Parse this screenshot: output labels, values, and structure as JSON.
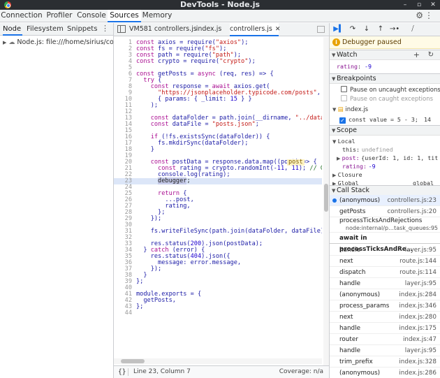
{
  "window": {
    "title": "DevTools - Node.js",
    "minimize": "–",
    "maximize": "▫",
    "close": "✕"
  },
  "main_tabs": [
    {
      "label": "Connection"
    },
    {
      "label": "Profiler"
    },
    {
      "label": "Console"
    },
    {
      "label": "Sources"
    },
    {
      "label": "Memory"
    }
  ],
  "navigator": {
    "tabs": [
      {
        "label": "Node"
      },
      {
        "label": "Filesystem"
      },
      {
        "label": "Snippets"
      }
    ],
    "tree_item": "Node.js: file:///home/sirius/coding/a"
  },
  "editor": {
    "tabs": [
      {
        "label": "VM581 controllers.js"
      },
      {
        "label": "index.js"
      },
      {
        "label": "controllers.js"
      }
    ],
    "close_glyph": "✕",
    "inline_value": "post",
    "status": {
      "braces": "{}",
      "position": "Line 23, Column 7",
      "coverage": "Coverage: n/a"
    },
    "lines": [
      {
        "n": "1",
        "html": "<span class=\"kw\">const</span> axios = require(<span class=\"str\">\"axios\"</span>);"
      },
      {
        "n": "2",
        "html": "<span class=\"kw\">const</span> fs = require(<span class=\"str\">\"fs\"</span>);"
      },
      {
        "n": "3",
        "html": "<span class=\"kw\">const</span> path = require(<span class=\"str\">\"path\"</span>);"
      },
      {
        "n": "4",
        "html": "<span class=\"kw\">const</span> crypto = require(<span class=\"str\">\"crypto\"</span>);"
      },
      {
        "n": "5",
        "html": ""
      },
      {
        "n": "6",
        "html": "<span class=\"kw\">const</span> getPosts = <span class=\"kw\">async</span> (req, res) => {"
      },
      {
        "n": "7",
        "html": "  <span class=\"kw\">try</span> {"
      },
      {
        "n": "8",
        "html": "    <span class=\"kw\">const</span> response = <span class=\"kw\">await</span> axios.get("
      },
      {
        "n": "9",
        "html": "      <span class=\"str\">\"https://jsonplaceholder.typicode.com/posts\"</span>,"
      },
      {
        "n": "10",
        "html": "      { params: { _limit: <span class=\"num\">15</span> } }"
      },
      {
        "n": "11",
        "html": "    );"
      },
      {
        "n": "12",
        "html": ""
      },
      {
        "n": "13",
        "html": "    <span class=\"kw\">const</span> dataFolder = path.join(__dirname, <span class=\"str\">\"../data\"</span>);"
      },
      {
        "n": "14",
        "html": "    <span class=\"kw\">const</span> dataFile = <span class=\"str\">\"posts.json\"</span>;"
      },
      {
        "n": "15",
        "html": ""
      },
      {
        "n": "16",
        "html": "    <span class=\"kw\">if</span> (!fs.existsSync(dataFolder)) {"
      },
      {
        "n": "17",
        "html": "      fs.mkdirSync(dataFolder);"
      },
      {
        "n": "18",
        "html": "    }"
      },
      {
        "n": "19",
        "html": ""
      },
      {
        "n": "20",
        "html": "    <span class=\"kw\">const</span> postData = response.data.map((post) => {"
      },
      {
        "n": "21",
        "html": "      <span class=\"kw\">const</span> rating = crypto.randomInt(-<span class=\"num\">11</span>, <span class=\"num\">11</span>); <span class=\"cm\">// Genera</span>"
      },
      {
        "n": "22",
        "html": "      console.log(rating);"
      },
      {
        "n": "23",
        "html": "      <span class=\"dbg\">debugger</span>;"
      },
      {
        "n": "24",
        "html": ""
      },
      {
        "n": "25",
        "html": "      <span class=\"kw\">return</span> {"
      },
      {
        "n": "26",
        "html": "        ...post,"
      },
      {
        "n": "27",
        "html": "        rating,"
      },
      {
        "n": "28",
        "html": "      };"
      },
      {
        "n": "29",
        "html": "    });"
      },
      {
        "n": "30",
        "html": ""
      },
      {
        "n": "31",
        "html": "    fs.writeFileSync(path.join(dataFolder, dataFile), JSO"
      },
      {
        "n": "32",
        "html": ""
      },
      {
        "n": "33",
        "html": "    res.status(<span class=\"num\">200</span>).json(postData);"
      },
      {
        "n": "34",
        "html": "  } <span class=\"kw\">catch</span> (error) {"
      },
      {
        "n": "35",
        "html": "    res.status(<span class=\"num\">404</span>).json({"
      },
      {
        "n": "36",
        "html": "      message: error.message,"
      },
      {
        "n": "37",
        "html": "    });"
      },
      {
        "n": "38",
        "html": "  }"
      },
      {
        "n": "39",
        "html": "};"
      },
      {
        "n": "40",
        "html": ""
      },
      {
        "n": "41",
        "html": "module.exports = {"
      },
      {
        "n": "42",
        "html": "  getPosts,"
      },
      {
        "n": "43",
        "html": "};"
      },
      {
        "n": "44",
        "html": ""
      }
    ]
  },
  "debugger": {
    "paused_text": "Debugger paused",
    "watch": {
      "title": "Watch",
      "expr": "rating",
      "value": "-9"
    },
    "breakpoints": {
      "title": "Breakpoints",
      "uncaught": "Pause on uncaught exceptions",
      "caught": "Pause on caught exceptions",
      "file": "index.js",
      "bp_code": "const value = 5 - 3;",
      "bp_line": "14"
    },
    "scope": {
      "title": "Scope",
      "local": "Local",
      "this_key": "this:",
      "this_val": "undefined",
      "post_key": "post:",
      "post_val": "{userId: 1, id: 1, tit",
      "rating_key": "rating:",
      "rating_val": "-9",
      "closure": "Closure",
      "global": "Global",
      "global_val": "global"
    },
    "call_stack": {
      "title": "Call Stack",
      "frames": [
        {
          "fn": "(anonymous)",
          "loc": "controllers.js:23"
        },
        {
          "fn": "getPosts",
          "loc": "controllers.js:20"
        },
        {
          "fn": "processTicksAndRejections",
          "loc": "node:internal/p…task_queues:95"
        },
        {
          "fn": "await in processTicksAndRe…",
          "loc": ""
        },
        {
          "fn": "handle",
          "loc": "layer.js:95"
        },
        {
          "fn": "next",
          "loc": "route.js:144"
        },
        {
          "fn": "dispatch",
          "loc": "route.js:114"
        },
        {
          "fn": "handle",
          "loc": "layer.js:95"
        },
        {
          "fn": "(anonymous)",
          "loc": "index.js:284"
        },
        {
          "fn": "process_params",
          "loc": "index.js:346"
        },
        {
          "fn": "next",
          "loc": "index.js:280"
        },
        {
          "fn": "handle",
          "loc": "index.js:175"
        },
        {
          "fn": "router",
          "loc": "index.js:47"
        },
        {
          "fn": "handle",
          "loc": "layer.js:95"
        },
        {
          "fn": "trim_prefix",
          "loc": "index.js:328"
        },
        {
          "fn": "(anonymous)",
          "loc": "index.js:286"
        }
      ]
    }
  }
}
